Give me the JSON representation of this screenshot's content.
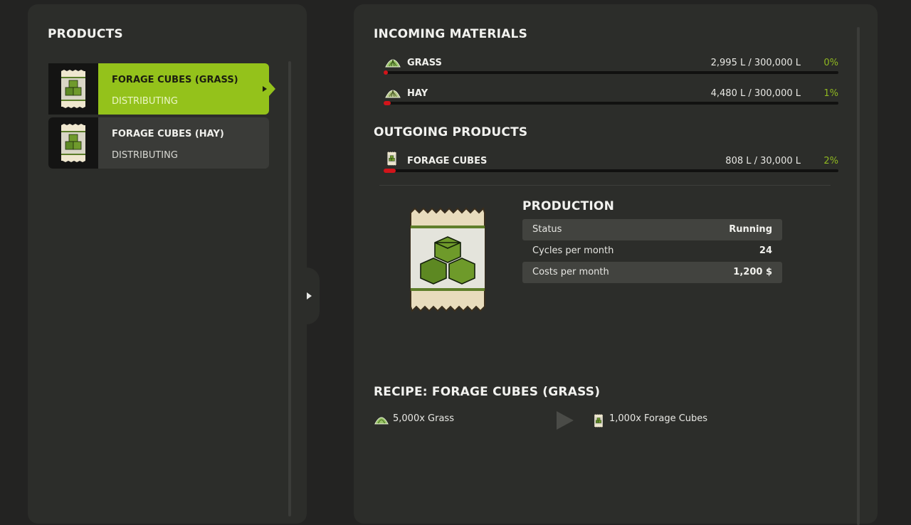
{
  "products_panel": {
    "title": "PRODUCTS",
    "items": [
      {
        "name": "FORAGE CUBES (GRASS)",
        "status": "DISTRIBUTING",
        "icon": "forage-cubes-icon",
        "selected": true
      },
      {
        "name": "FORAGE CUBES (HAY)",
        "status": "DISTRIBUTING",
        "icon": "forage-cubes-icon",
        "selected": false
      }
    ]
  },
  "incoming": {
    "title": "INCOMING MATERIALS",
    "items": [
      {
        "name": "GRASS",
        "amount": "2,995 L / 300,000 L",
        "percent": "0%",
        "fill": 0.0,
        "icon": "grass-icon"
      },
      {
        "name": "HAY",
        "amount": "4,480 L / 300,000 L",
        "percent": "1%",
        "fill": 0.0149,
        "icon": "hay-icon"
      }
    ]
  },
  "outgoing": {
    "title": "OUTGOING PRODUCTS",
    "items": [
      {
        "name": "FORAGE CUBES",
        "amount": "808 L / 30,000 L",
        "percent": "2%",
        "fill": 0.027,
        "icon": "forage-cubes-icon"
      }
    ]
  },
  "production": {
    "title": "PRODUCTION",
    "rows": [
      {
        "label": "Status",
        "value": "Running"
      },
      {
        "label": "Cycles per month",
        "value": "24"
      },
      {
        "label": "Costs per month",
        "value": "1,200 $"
      }
    ]
  },
  "recipe": {
    "title": "RECIPE: FORAGE CUBES (GRASS)",
    "input": "5,000x Grass",
    "output": "1,000x Forage Cubes"
  },
  "colors": {
    "accent": "#94c21b",
    "fill_bar": "#d2141a",
    "percent_text": "#8fb820"
  }
}
